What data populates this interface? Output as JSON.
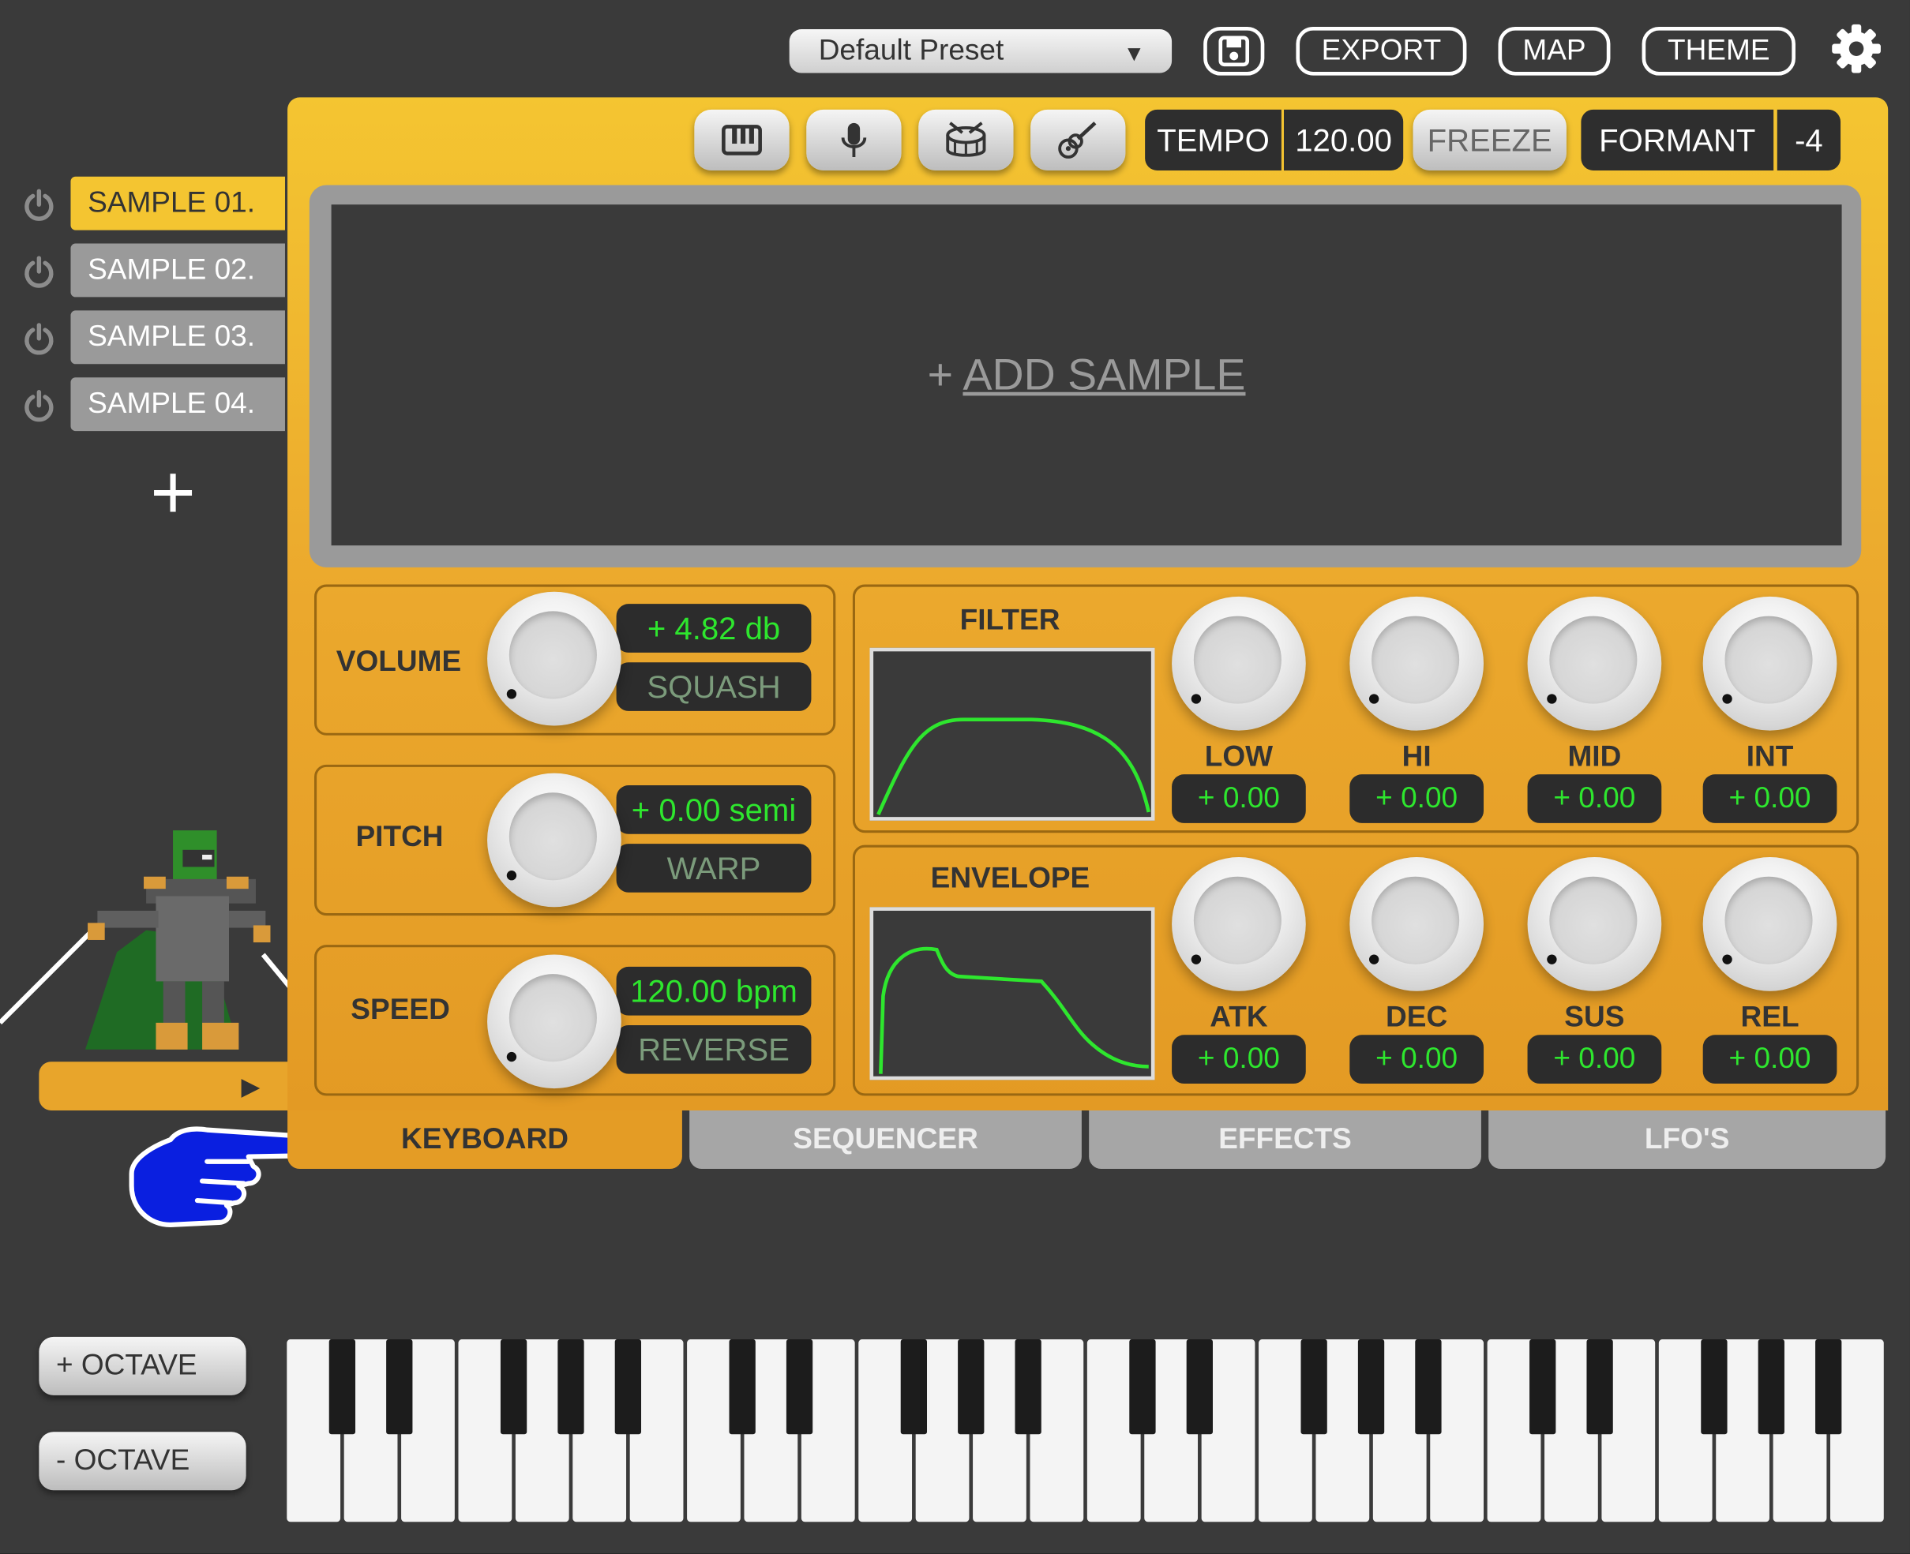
{
  "header": {
    "preset_label": "Default Preset",
    "caret": "▼",
    "export_label": "EXPORT",
    "map_label": "MAP",
    "theme_label": "THEME"
  },
  "toolbar": {
    "tempo_label": "TEMPO",
    "tempo_value": "120.00",
    "freeze_label": "FREEZE",
    "formant_label": "FORMANT",
    "formant_value": "-4"
  },
  "samples": {
    "items": [
      "SAMPLE 01.",
      "SAMPLE 02.",
      "SAMPLE 03.",
      "SAMPLE 04."
    ],
    "active_index": 0,
    "add_label": "+"
  },
  "waveform": {
    "plus": "+",
    "add_sample_label": "ADD SAMPLE"
  },
  "volume": {
    "label": "VOLUME",
    "value": "+ 4.82 db",
    "mode": "SQUASH"
  },
  "pitch": {
    "label": "PITCH",
    "value": "+ 0.00 semi",
    "mode": "WARP"
  },
  "speed": {
    "label": "SPEED",
    "value": "120.00 bpm",
    "mode": "REVERSE"
  },
  "filter": {
    "title": "FILTER",
    "knobs": [
      {
        "label": "LOW",
        "value": "+ 0.00"
      },
      {
        "label": "HI",
        "value": "+ 0.00"
      },
      {
        "label": "MID",
        "value": "+ 0.00"
      },
      {
        "label": "INT",
        "value": "+ 0.00"
      }
    ]
  },
  "envelope": {
    "title": "ENVELOPE",
    "knobs": [
      {
        "label": "ATK",
        "value": "+ 0.00"
      },
      {
        "label": "DEC",
        "value": "+ 0.00"
      },
      {
        "label": "SUS",
        "value": "+ 0.00"
      },
      {
        "label": "REL",
        "value": "+ 0.00"
      }
    ]
  },
  "tabs": [
    "KEYBOARD",
    "SEQUENCER",
    "EFFECTS",
    "LFO'S"
  ],
  "active_tab": "KEYBOARD",
  "octave": {
    "up_label": "+ OCTAVE",
    "down_label": "- OCTAVE"
  },
  "player": {
    "play_icon": "▶"
  },
  "colors": {
    "accent": "#f4c531",
    "value_green": "#2ee62e",
    "background": "#3a3a3a",
    "pointer_blue": "#0a1fe0"
  },
  "icons": [
    "gear-icon",
    "save-icon",
    "piano-icon",
    "microphone-icon",
    "drum-icon",
    "guitar-icon",
    "power-icon",
    "play-icon",
    "pointing-hand-icon"
  ]
}
